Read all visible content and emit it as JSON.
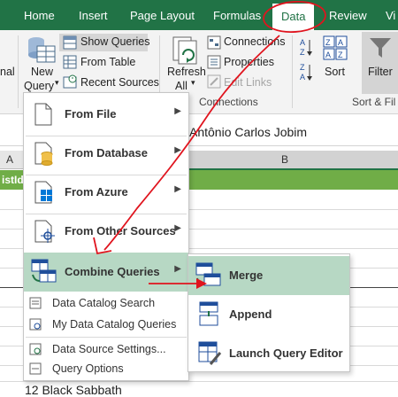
{
  "ribbon_tabs": [
    "Home",
    "Insert",
    "Page Layout",
    "Formulas",
    "Data",
    "Review",
    "Vi"
  ],
  "ribbon": {
    "left_partial": "nal",
    "new_query": "New",
    "new_query_2": "Query",
    "show_queries": "Show Queries",
    "from_table": "From Table",
    "recent_sources": "Recent Sources",
    "refresh": "Refresh",
    "refresh_2": "All",
    "connections": "Connections",
    "properties": "Properties",
    "edit_links": "Edit Links",
    "sort": "Sort",
    "filter": "Filter",
    "group_connections": "Connections",
    "group_sort_filter": "Sort & Fil"
  },
  "formula_bar": {
    "value": "Antônio Carlos Jobim"
  },
  "grid": {
    "col_a": "A",
    "col_b": "B",
    "header_cell": "istId",
    "bottom_row": "12 Black Sabbath"
  },
  "menu": {
    "items": [
      {
        "label": "From File",
        "icon": "file-icon"
      },
      {
        "label": "From Database",
        "icon": "database-icon"
      },
      {
        "label": "From Azure",
        "icon": "azure-icon"
      },
      {
        "label": "From Other Sources",
        "icon": "other-sources-icon"
      },
      {
        "label": "Combine Queries",
        "icon": "combine-icon"
      }
    ],
    "small_items": [
      {
        "label": "Data Catalog Search"
      },
      {
        "label": "My Data Catalog Queries"
      },
      {
        "label": "Data Source Settings..."
      },
      {
        "label": "Query Options"
      }
    ]
  },
  "submenu": {
    "items": [
      {
        "label": "Merge"
      },
      {
        "label": "Append"
      },
      {
        "label": "Launch Query Editor"
      }
    ]
  },
  "colors": {
    "excel_green": "#217346",
    "highlight": "#b7d8c4",
    "annotation": "#e0141e",
    "table_header": "#70ad47"
  }
}
